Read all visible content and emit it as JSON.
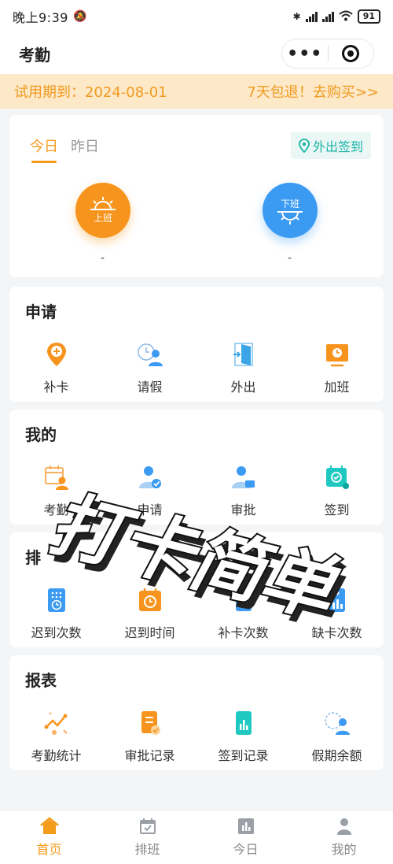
{
  "status_bar": {
    "time": "晚上9:39",
    "battery": "91"
  },
  "header": {
    "title": "考勤"
  },
  "trial": {
    "text": "试用期到：2024-08-01",
    "buy": "7天包退！去购买>>"
  },
  "today": {
    "tabs": [
      "今日",
      "昨日"
    ],
    "out_sign": "外出签到",
    "clock_in_label": "上班",
    "clock_out_label": "下班",
    "clock_in_time": "-",
    "clock_out_time": "-"
  },
  "apply": {
    "title": "申请",
    "items": [
      "补卡",
      "请假",
      "外出",
      "加班"
    ]
  },
  "mine": {
    "title": "我的",
    "items": [
      "考勤",
      "申请",
      "审批",
      "签到"
    ]
  },
  "stats": {
    "title": "排",
    "items": [
      "迟到次数",
      "迟到时间",
      "补卡次数",
      "缺卡次数"
    ]
  },
  "report": {
    "title": "报表",
    "items": [
      "考勤统计",
      "审批记录",
      "签到记录",
      "假期余额"
    ]
  },
  "tabbar": {
    "items": [
      "首页",
      "排班",
      "今日",
      "我的"
    ]
  },
  "overlay_text": "打卡简单",
  "colors": {
    "accent": "#f49b1c",
    "blue": "#3b9af2",
    "teal": "#19b3a6"
  }
}
